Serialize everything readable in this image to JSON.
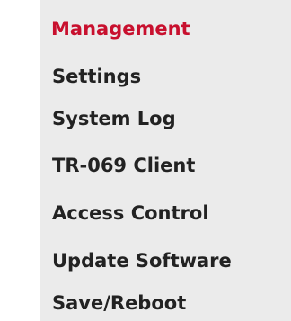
{
  "menu": {
    "header": "Management",
    "items": [
      {
        "label": "Settings"
      },
      {
        "label": "System Log"
      },
      {
        "label": "TR-069 Client"
      },
      {
        "label": "Access Control"
      },
      {
        "label": "Update Software"
      },
      {
        "label": "Save/Reboot"
      }
    ]
  },
  "colors": {
    "header_text": "#c8102e",
    "item_text": "#222222",
    "panel_background": "#ebebeb"
  }
}
